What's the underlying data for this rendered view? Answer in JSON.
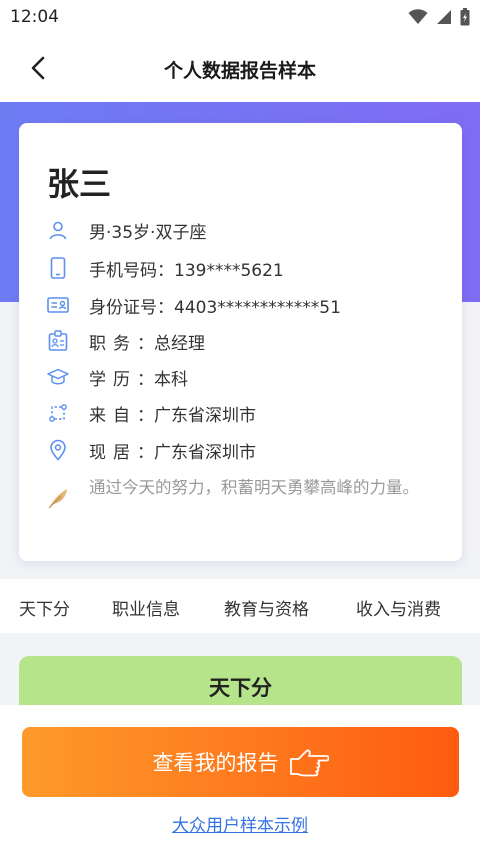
{
  "status_bar": {
    "time": "12:04"
  },
  "nav": {
    "title": "个人数据报告样本"
  },
  "profile": {
    "name": "张三",
    "basic": "男·35岁·双子座",
    "phone_label": "手机号码：",
    "phone_value": "139****5621",
    "id_label": "身份证号：",
    "id_value": "4403************51",
    "job_label": "职务：",
    "job_value": "总经理",
    "edu_label": "学历：",
    "edu_value": "本科",
    "from_label": "来自：",
    "from_value": "广东省深圳市",
    "live_label": "现居：",
    "live_value": "广东省深圳市",
    "motto": "通过今天的努力，积蓄明天勇攀高峰的力量。"
  },
  "tabs": [
    "天下分",
    "职业信息",
    "教育与资格",
    "收入与消费"
  ],
  "section": {
    "title": "天下分"
  },
  "cta": {
    "label": "查看我的报告"
  },
  "sample_link": "大众用户样本示例",
  "colors": {
    "accent": "#5b8ff0",
    "hero": "#7475f4",
    "cta_start": "#fe9a2c",
    "cta_end": "#fe5b10",
    "section": "#b6e48a",
    "link": "#3573e0"
  }
}
